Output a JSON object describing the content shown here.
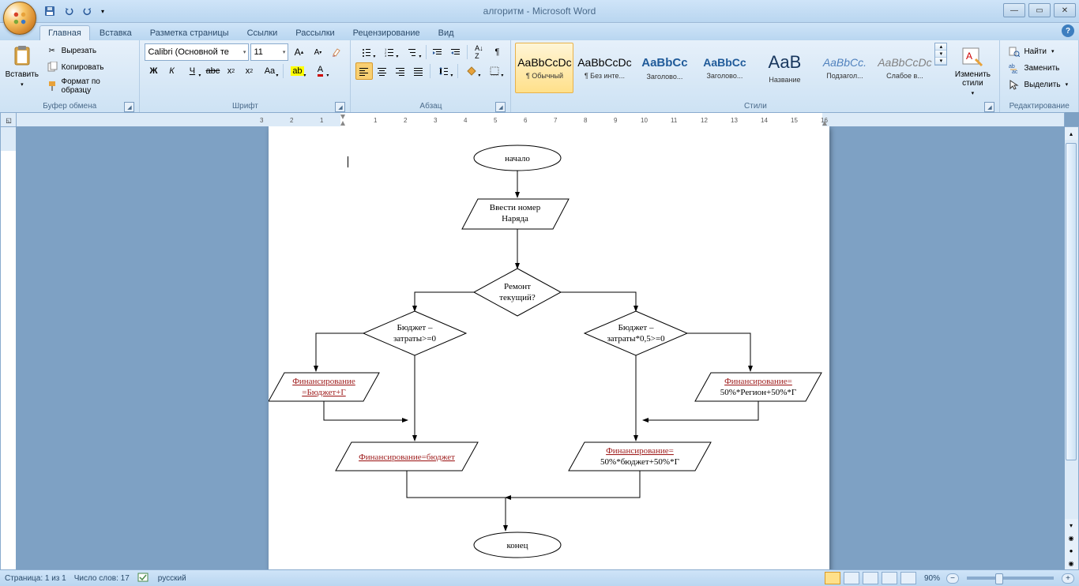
{
  "app_title": "алгоритм - Microsoft Word",
  "qat_keys": [
    "1",
    "2",
    "3"
  ],
  "tabs": [
    {
      "label": "Главная",
      "key": "Я",
      "active": true
    },
    {
      "label": "Вставка",
      "key": "С"
    },
    {
      "label": "Разметка страницы",
      "key": "."
    },
    {
      "label": "Ссылки",
      "key": ""
    },
    {
      "label": "Рассылки",
      "key": "Ц"
    },
    {
      "label": "Рецензирование",
      "key": ""
    },
    {
      "label": "Вид",
      "key": ""
    }
  ],
  "clipboard": {
    "paste": "Вставить",
    "cut": "Вырезать",
    "copy": "Копировать",
    "painter": "Формат по образцу",
    "group": "Буфер обмена"
  },
  "font": {
    "group": "Шрифт",
    "name": "Calibri (Основной те",
    "size": "11"
  },
  "paragraph": {
    "group": "Абзац"
  },
  "styles": {
    "group": "Стили",
    "change": "Изменить стили",
    "items": [
      {
        "preview": "AaBbCcDc",
        "name": "¶ Обычный",
        "sel": true,
        "color": "#000"
      },
      {
        "preview": "AaBbCcDc",
        "name": "¶ Без инте...",
        "color": "#000"
      },
      {
        "preview": "AaBbCc",
        "name": "Заголово...",
        "color": "#1f5a99",
        "bold": true,
        "size": "15px"
      },
      {
        "preview": "AaBbCc",
        "name": "Заголово...",
        "color": "#1f5a99",
        "bold": true,
        "size": "14px"
      },
      {
        "preview": "АаВ",
        "name": "Название",
        "color": "#17365d",
        "size": "22px"
      },
      {
        "preview": "AaBbCc.",
        "name": "Подзагол...",
        "color": "#4f81bd",
        "italic": true
      },
      {
        "preview": "AaBbCcDc",
        "name": "Слабое в...",
        "color": "#808080",
        "italic": true
      }
    ]
  },
  "editing": {
    "group": "Редактирование",
    "find": "Найти",
    "replace": "Заменить",
    "select": "Выделить"
  },
  "status": {
    "page": "Страница: 1 из 1",
    "words": "Число слов: 17",
    "lang": "русский",
    "zoom": "90%"
  },
  "flowchart": {
    "start": "начало",
    "input": "Ввести номер Наряда",
    "d1": "Ремонт текущий?",
    "d2": "Бюджет – затраты>=0",
    "d3": "Бюджет – затраты*0,5>=0",
    "p1": "Финансирование =Бюджет+Г",
    "p2": "Финансирование=бюджет",
    "p3": "Финансирование= 50%*Регион+50%*Г",
    "p4": "Финансирование= 50%*бюджет+50%*Г",
    "end": "конец"
  }
}
